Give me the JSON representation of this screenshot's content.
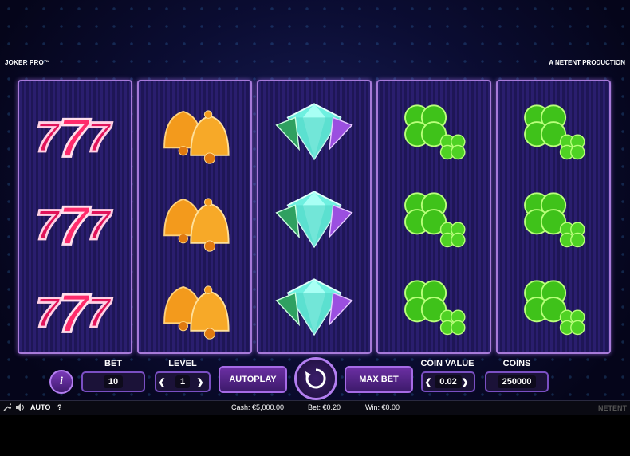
{
  "game": {
    "title": "JOKER PRO™",
    "producer": "A NETENT PRODUCTION"
  },
  "reels": [
    {
      "symbols": [
        "seven",
        "seven",
        "seven"
      ]
    },
    {
      "symbols": [
        "bell",
        "bell",
        "bell"
      ]
    },
    {
      "symbols": [
        "diamond",
        "diamond",
        "diamond"
      ]
    },
    {
      "symbols": [
        "clover",
        "clover",
        "clover"
      ]
    },
    {
      "symbols": [
        "clover",
        "clover",
        "clover"
      ]
    }
  ],
  "controls": {
    "info_label": "i",
    "bet_label": "BET",
    "bet_value": "10",
    "level_label": "LEVEL",
    "level_value": "1",
    "autoplay_label": "AUTOPLAY",
    "max_bet_label": "MAX BET",
    "coin_value_label": "COIN VALUE",
    "coin_value": "0.02",
    "coins_label": "COINS",
    "coins_value": "250000",
    "prev": "❮",
    "next": "❯"
  },
  "status": {
    "auto": "AUTO",
    "help": "?",
    "cash": "Cash: €5,000.00",
    "bet": "Bet: €0.20",
    "win": "Win: €0.00",
    "brand": "NETENT"
  },
  "colors": {
    "accent": "#a66ae6",
    "reel_bg": "#2a1e6e",
    "seven": "#e0145a",
    "bell": "#f39a1c",
    "diamond": "#5fe6d6",
    "clover": "#3fc21a"
  }
}
